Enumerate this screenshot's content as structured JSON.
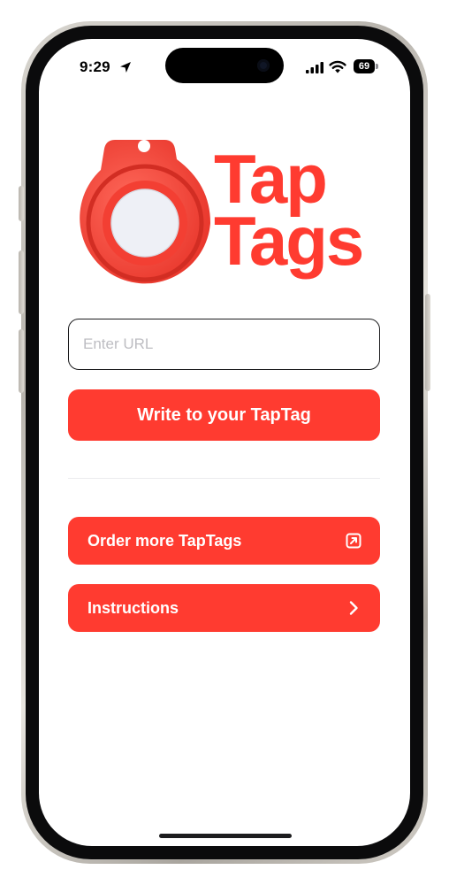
{
  "status_bar": {
    "time": "9:29",
    "battery": "69"
  },
  "logo": {
    "line1": "Tap",
    "line2": "Tags",
    "accent_color": "#ff3b30"
  },
  "url_field": {
    "placeholder": "Enter URL",
    "value": ""
  },
  "write_button": {
    "label": "Write to your TapTag"
  },
  "menu": {
    "order_label": "Order more TapTags",
    "order_icon": "external-link-icon",
    "instructions_label": "Instructions",
    "instructions_icon": "chevron-right-icon"
  }
}
